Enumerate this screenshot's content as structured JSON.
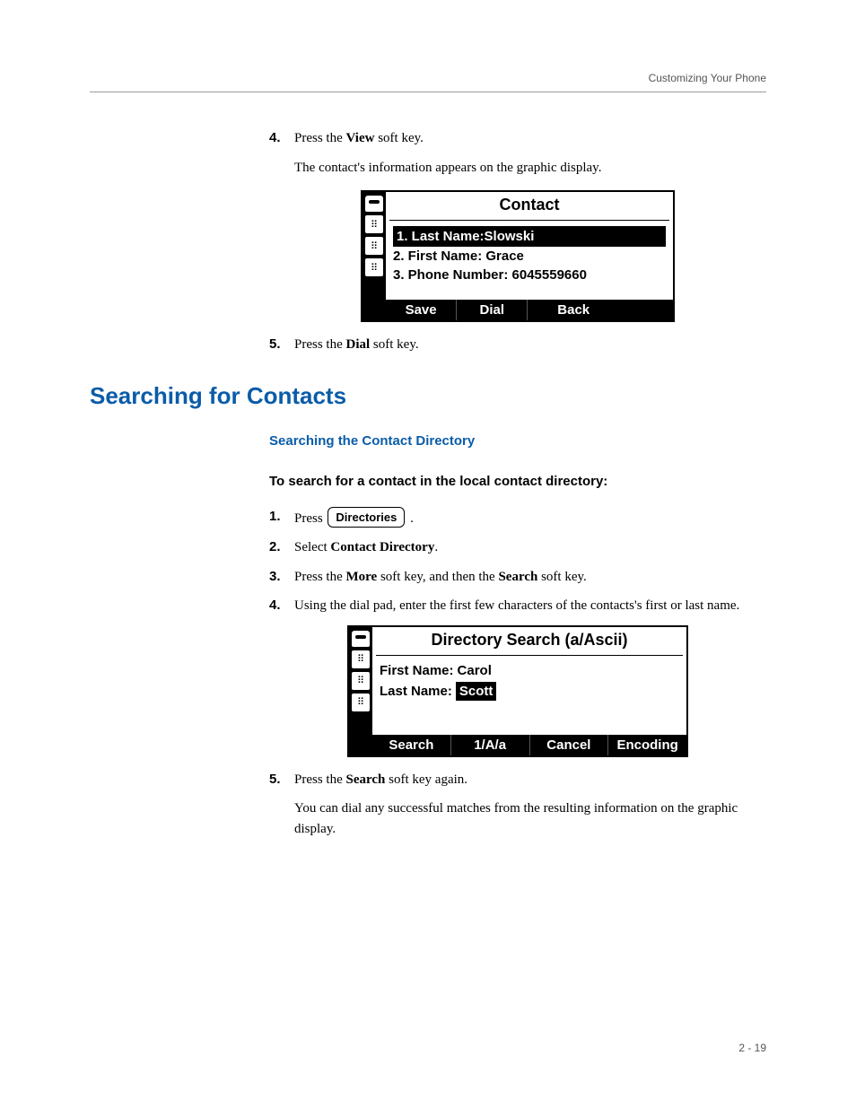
{
  "header": {
    "chapter": "Customizing Your Phone"
  },
  "steps_a": {
    "s4": {
      "num": "4.",
      "before": "Press the ",
      "bold": "View",
      "after": " soft key.",
      "follow": "The contact's information appears on the graphic display."
    },
    "s5": {
      "num": "5.",
      "before": "Press the ",
      "bold": "Dial",
      "after": " soft key."
    }
  },
  "screen1": {
    "title": "Contact",
    "line1": "1. Last Name:Slowski",
    "line2": "2. First Name: Grace",
    "line3": "3. Phone Number: 6045559660",
    "sk": [
      "Save",
      "Dial",
      "Back"
    ]
  },
  "section": {
    "heading": "Searching for Contacts",
    "sub": "Searching the Contact Directory",
    "lead": "To search for a contact in the local contact directory:"
  },
  "steps_b": {
    "s1": {
      "num": "1.",
      "before": "Press ",
      "key": "Directories",
      "after": " ."
    },
    "s2": {
      "num": "2.",
      "before": "Select ",
      "bold": "Contact Directory",
      "after": "."
    },
    "s3": {
      "num": "3.",
      "before": "Press the ",
      "bold1": "More",
      "mid": " soft key, and then the ",
      "bold2": "Search",
      "after": " soft key."
    },
    "s4": {
      "num": "4.",
      "text": "Using the dial pad, enter the first few characters of the contacts's first or last name."
    },
    "s5": {
      "num": "5.",
      "before": "Press the ",
      "bold": "Search",
      "after": " soft key again.",
      "follow": "You can dial any successful matches from the resulting information on the graphic display."
    }
  },
  "screen2": {
    "title": "Directory Search (a/Ascii)",
    "fn_label": "First Name:",
    "fn_val": "Carol",
    "ln_label": "Last Name:",
    "ln_val": "Scott",
    "sk": [
      "Search",
      "1/A/a",
      "Cancel",
      "Encoding"
    ]
  },
  "footer": {
    "page": "2 - 19"
  },
  "icons": {
    "grid": "⠿"
  }
}
